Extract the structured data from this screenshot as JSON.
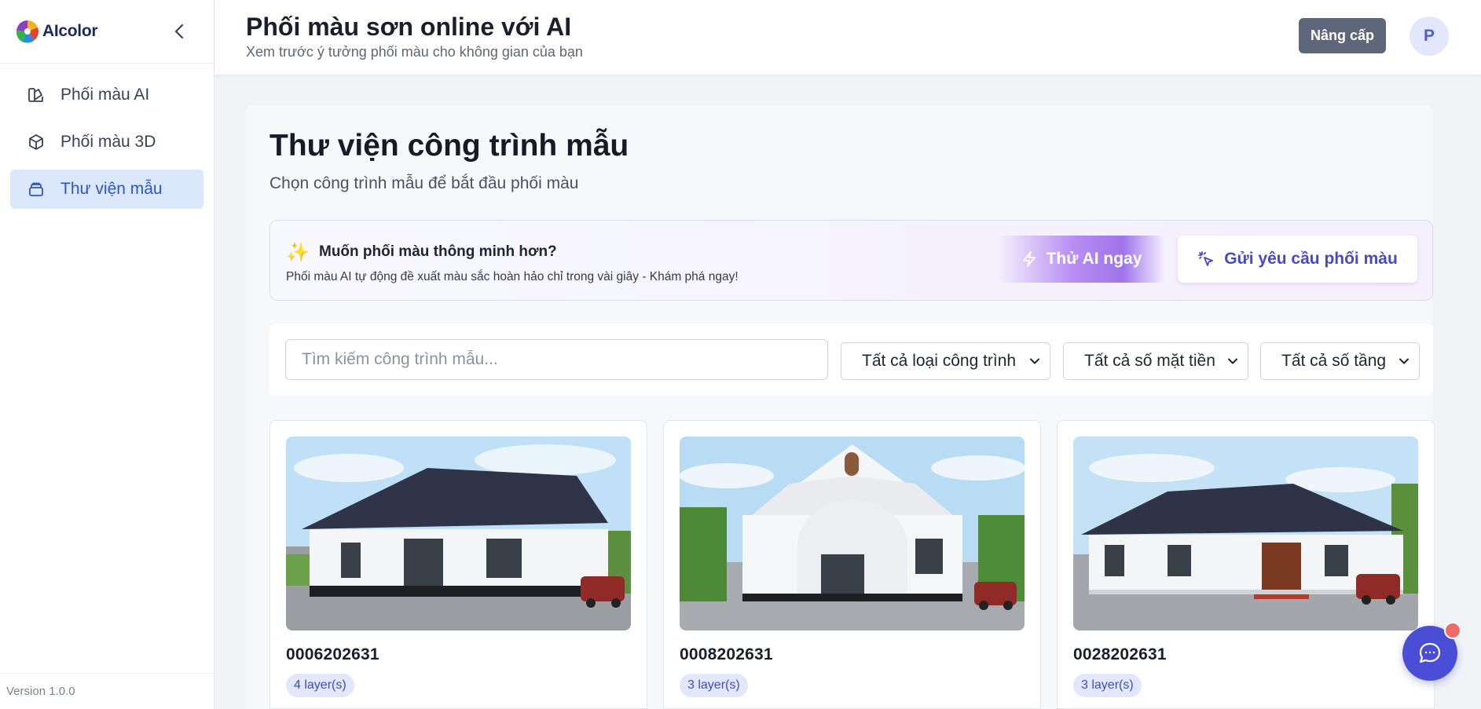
{
  "app": {
    "logo_text": "AIcolor",
    "version": "Version 1.0.0"
  },
  "sidebar": {
    "items": [
      {
        "label": "Phối màu AI",
        "icon": "palette-icon",
        "active": false
      },
      {
        "label": "Phối màu 3D",
        "icon": "cube-icon",
        "active": false
      },
      {
        "label": "Thư viện mẫu",
        "icon": "library-icon",
        "active": true
      }
    ]
  },
  "header": {
    "title": "Phối màu sơn online với AI",
    "subtitle": "Xem trước ý tưởng phối màu cho không gian của bạn",
    "upgrade_label": "Nâng cấp",
    "avatar_initial": "P"
  },
  "library": {
    "title": "Thư viện công trình mẫu",
    "subtitle": "Chọn công trình mẫu để bắt đầu phối màu"
  },
  "promo": {
    "title": "Muốn phối màu thông minh hơn?",
    "description": "Phối màu AI tự động đề xuất màu sắc hoàn hảo chỉ trong vài giây - Khám phá ngay!",
    "try_ai_label": "Thử AI ngay",
    "request_label": "Gửi yêu cầu phối màu"
  },
  "filters": {
    "search_placeholder": "Tìm kiếm công trình mẫu...",
    "building_type": "Tất cả loại công trình",
    "frontage": "Tất cả số mặt tiền",
    "floors": "Tất cả số tầng"
  },
  "cards": [
    {
      "code": "0006202631",
      "layers": "4 layer(s)"
    },
    {
      "code": "0008202631",
      "layers": "3 layer(s)"
    },
    {
      "code": "0028202631",
      "layers": "3 layer(s)"
    }
  ],
  "colors": {
    "accent": "#4a4ed6",
    "active_nav_bg": "#dbe8fb",
    "active_nav_text": "#2b56c9",
    "upgrade_bg": "#5d6779",
    "badge_bg": "#e2e7fb",
    "notification": "#f06a6a"
  }
}
